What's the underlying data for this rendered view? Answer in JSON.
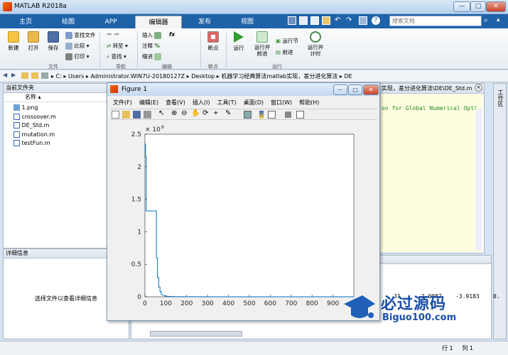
{
  "app": {
    "title": "MATLAB R2018a"
  },
  "tabs": [
    "主页",
    "绘图",
    "APP",
    "编辑器",
    "发布",
    "视图"
  ],
  "search": {
    "placeholder": "搜索文档"
  },
  "ribbon": {
    "file": {
      "new": "新建",
      "open": "打开",
      "save": "保存",
      "find_files": "查找文件",
      "compare": "比较",
      "print": "打印",
      "group": "文件"
    },
    "nav": {
      "goto": "转至",
      "find": "查找",
      "group": "导航"
    },
    "edit": {
      "insert": "插入",
      "comment": "注释",
      "indent": "缩进",
      "fx": "fx",
      "group": "编辑"
    },
    "breakpoints": {
      "label": "断点",
      "group": "断点"
    },
    "run": {
      "run": "运行",
      "run_advance": "运行并\n前进",
      "run_section": "运行节",
      "advance": "前进",
      "run_time": "运行并\n计时",
      "group": "运行"
    }
  },
  "address": {
    "parts": [
      "C:",
      "Users",
      "Administrator.WIN7U-20180127Z",
      "Desktop",
      "机器学习经典算法matlab实现，差分进化算法",
      "DE"
    ]
  },
  "current_folder": {
    "title": "当前文件夹",
    "col_name": "名称",
    "files": [
      "1.png",
      "crossover.m",
      "DE_Std.m",
      "mutation.m",
      "testFun.m"
    ]
  },
  "details": {
    "title": "详细信息",
    "empty_text": "选择文件以查看详细信息"
  },
  "editor": {
    "path": "实现，差分进化算法\\DE\\DE_Std.m",
    "code_line": "on for Global Numerical Opti"
  },
  "right_panel": {
    "title": "工作区"
  },
  "command_window": {
    "values": [
      "31",
      "2.0087",
      "-3.9183",
      "0."
    ]
  },
  "figure": {
    "title": "Figure 1",
    "menus": [
      "文件(F)",
      "编辑(E)",
      "查看(V)",
      "插入(I)",
      "工具(T)",
      "桌面(D)",
      "窗口(W)",
      "帮助(H)"
    ]
  },
  "chart_data": {
    "type": "line",
    "title": "",
    "xlabel": "",
    "ylabel": "",
    "y_multiplier_label": "× 10^8",
    "y_exponent_label": "8",
    "xlim": [
      0,
      1000
    ],
    "ylim": [
      0,
      2.5
    ],
    "xticks": [
      0,
      100,
      200,
      300,
      400,
      500,
      600,
      700,
      800,
      900
    ],
    "yticks": [
      0,
      0.5,
      1,
      1.5,
      2,
      2.5
    ],
    "series": [
      {
        "color": "#0072bd",
        "x": [
          0,
          3,
          3,
          6,
          6,
          10,
          10,
          55,
          55,
          60,
          60,
          66,
          66,
          72,
          72,
          78,
          78,
          90,
          100,
          120,
          150,
          200,
          400,
          700,
          1000
        ],
        "y": [
          2.35,
          2.35,
          2.15,
          2.15,
          1.32,
          1.32,
          1.32,
          1.32,
          0.6,
          0.6,
          0.3,
          0.3,
          0.15,
          0.15,
          0.08,
          0.08,
          0.04,
          0.02,
          0.01,
          0.005,
          0.002,
          0.001,
          0.0005,
          0.0003,
          0.0002
        ]
      }
    ]
  },
  "watermark": {
    "brand": "必过源码",
    "url": "Biguo100.com"
  },
  "statusbar": {
    "row_label": "行",
    "row": "1",
    "col_label": "列",
    "col": "1"
  }
}
